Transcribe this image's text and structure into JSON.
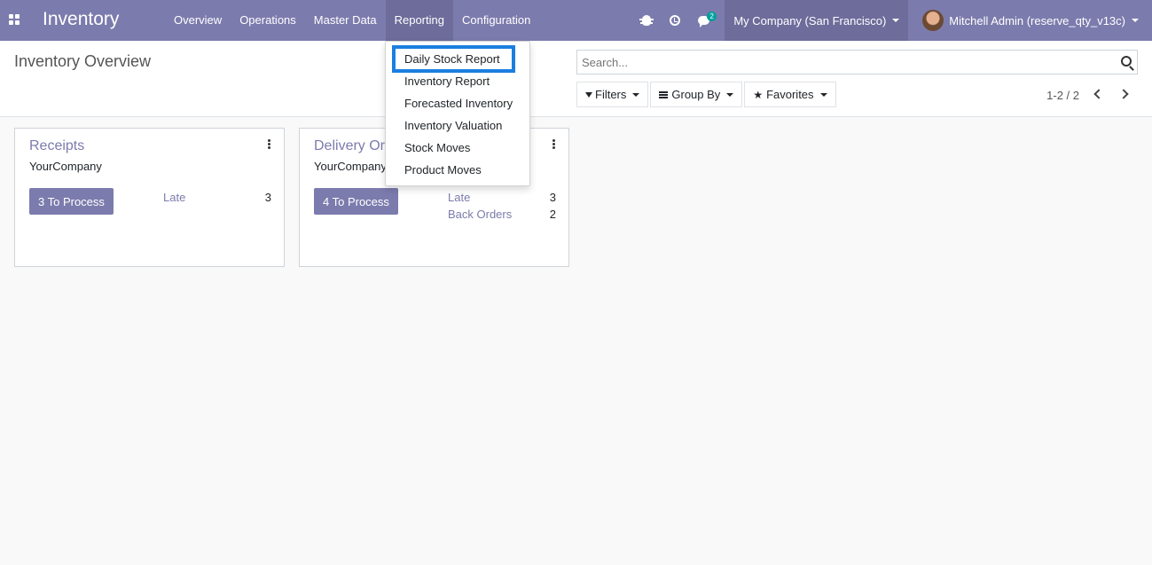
{
  "app": {
    "title": "Inventory"
  },
  "menu": {
    "items": [
      {
        "label": "Overview",
        "active": false
      },
      {
        "label": "Operations",
        "active": false
      },
      {
        "label": "Master Data",
        "active": false
      },
      {
        "label": "Reporting",
        "active": true
      },
      {
        "label": "Configuration",
        "active": false
      }
    ]
  },
  "systray": {
    "chat_count": "2",
    "company": "My Company (San Francisco)",
    "user": "Mitchell Admin (reserve_qty_v13c)"
  },
  "control_panel": {
    "title": "Inventory Overview",
    "search_placeholder": "Search...",
    "filters_label": "Filters",
    "groupby_label": "Group By",
    "favorites_label": "Favorites",
    "pager": "1-2 / 2"
  },
  "cards": [
    {
      "title": "Receipts",
      "company": "YourCompany",
      "button": "3 To Process",
      "stats": [
        {
          "label": "Late",
          "value": "3"
        }
      ]
    },
    {
      "title": "Delivery Orders",
      "company": "YourCompany",
      "button": "4 To Process",
      "stats": [
        {
          "label": "Late",
          "value": "3"
        },
        {
          "label": "Back Orders",
          "value": "2"
        }
      ]
    }
  ],
  "reporting_menu": {
    "items": [
      "Daily Stock Report",
      "Inventory Report",
      "Forecasted Inventory",
      "Inventory Valuation",
      "Stock Moves",
      "Product Moves"
    ],
    "highlighted": "Daily Stock Report"
  },
  "colors": {
    "brand": "#7c7bad",
    "highlight": "#1a7fe0",
    "badge": "#00a09d"
  }
}
